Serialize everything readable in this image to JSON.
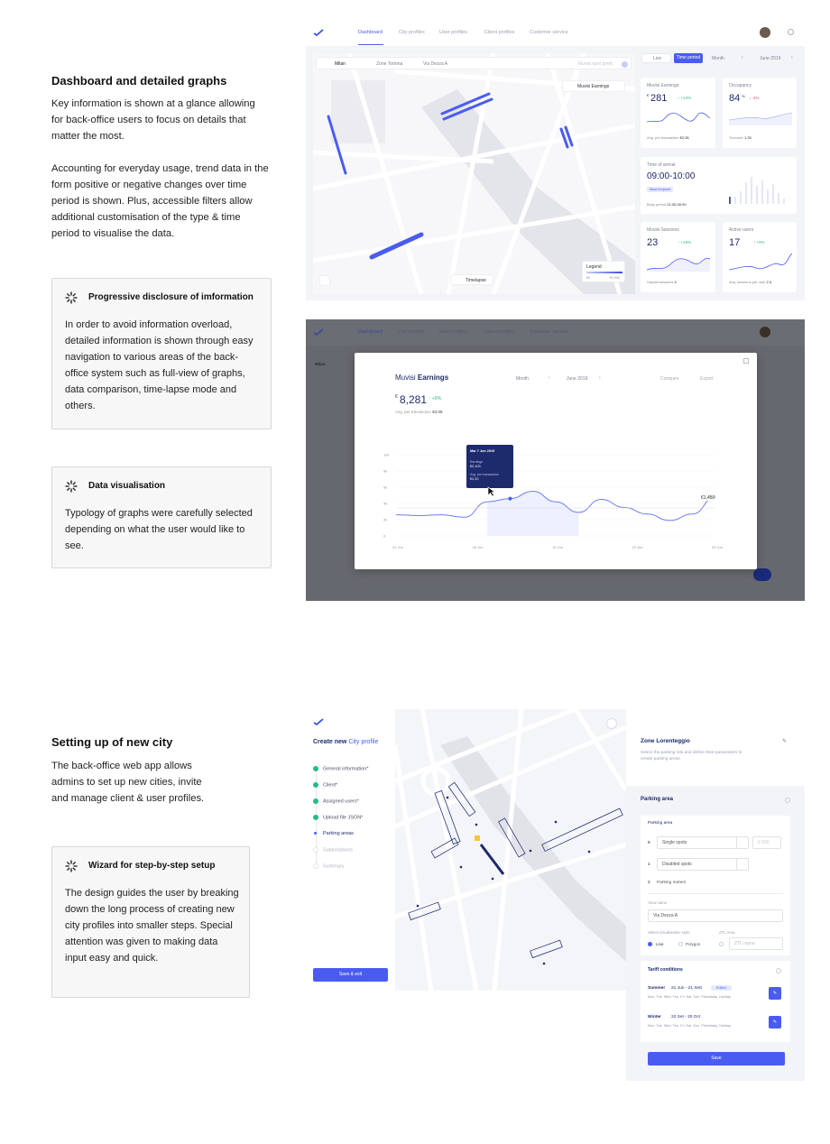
{
  "section1": {
    "title": "Dashboard and detailed graphs",
    "para1": "Key information is shown at a glance allowing for back-office users to focus on details that matter the most.",
    "para2": "Accounting for everyday usage, trend data in the form positive or negative changes over time period is shown. Plus, accessible filters allow additional customisation of the type & time period to visualise the data.",
    "card1": {
      "title": "Progressive disclosure of imformation",
      "text": "In order to avoid information overload, detailed information is shown through easy navigation to various areas of the back-office system such as full-view of graphs, data comparison, time-lapse mode and others."
    },
    "card2": {
      "title": "Data visualisation",
      "text": "Typology of graphs were carefully selected depending on what the user would like to see."
    }
  },
  "section2": {
    "title": "Setting up of new city",
    "para": "The back-office web app allows admins to set up new cities, invite and manage client & user profiles.",
    "card": {
      "title": "Wizard for step-by-step setup",
      "text": "The design guides the user by breaking down the long process of creating new city profiles into smaller steps. Special attention was given to making data input easy and quick."
    }
  },
  "dashboard": {
    "nav": [
      "Dashboard",
      "City profiles",
      "User profiles",
      "Client profiles",
      "Customer service"
    ],
    "filters": {
      "city": "Milan",
      "zone": "Zone Tortona",
      "street": "Via Dezza A",
      "search": "Muvisi spot (pmt)"
    },
    "layer": "Muvisi Earnings",
    "timelapse": "Timelapse",
    "legend": {
      "title": "Legend",
      "min": "€0",
      "max": "€1,000"
    },
    "toggle": {
      "live": "Live",
      "period": "Time period",
      "month": "Month",
      "date": "June 2019"
    },
    "widgets": {
      "earnings": {
        "title": "Muvisi Earnings",
        "value": "281",
        "currency": "€",
        "delta": "↑ +14%",
        "sub": "Avg. per transaction",
        "subval": "€2,05"
      },
      "occupancy": {
        "title": "Occupancy",
        "value": "84",
        "unit": "%",
        "delta": "↓ -2%",
        "sub": "Turnover",
        "subval": "1.25"
      },
      "arrival": {
        "title": "Time of arrival",
        "value": "09:00-10:00",
        "badge": "Most frequent",
        "sub": "Busy period",
        "subval": "21:30-00:00"
      },
      "sessions": {
        "title": "Muvisi Sessions",
        "value": "23",
        "delta": "↑ +15%",
        "sub": "Unpaid sessions",
        "subval": "4"
      },
      "users": {
        "title": "Active users",
        "value": "17",
        "delta": "↑ +9%",
        "sub": "Avg. sessions per user",
        "subval": "2.4"
      }
    }
  },
  "modal": {
    "title_a": "Muvisi",
    "title_b": "Earnings",
    "period": "Month",
    "date": "June 2019",
    "compare": "Compare",
    "export": "Export",
    "value": "8,281",
    "currency": "€",
    "delta": "↑ +9%",
    "sub": "Avg. per transaction",
    "subval": "€2,05",
    "tooltip": {
      "date": "Mar 7 Jun 2019",
      "l1": "Earnings",
      "v1": "€2,103",
      "l2": "Avg. per transaction",
      "v2": "€2,20"
    },
    "endlabel": "€1,450",
    "bg_street": "Milan"
  },
  "chart_data": {
    "type": "line",
    "x": [
      "01 Jun",
      "08 Jun",
      "15 Jun",
      "22 Jun",
      "29 Jun"
    ],
    "y_ticks": [
      "10k",
      "8k",
      "6k",
      "4k",
      "2k",
      "0"
    ],
    "series": [
      {
        "values": [
          2.6,
          2.5,
          2.6,
          2.3,
          4.2,
          4.6,
          5.5,
          4.2,
          2.9,
          4.5,
          3.5,
          2.7,
          1.9,
          2.7,
          4.8
        ]
      }
    ],
    "ylim": [
      0,
      10
    ]
  },
  "wizard": {
    "title_a": "Create new",
    "title_b": "City profile",
    "steps": [
      "General information*",
      "Client*",
      "Assigned users*",
      "Upload file JSON*",
      "Parking areas",
      "Subscriptions",
      "Summary"
    ],
    "save_exit": "Save & exit",
    "zone": {
      "title": "Zone Lorenteggio",
      "desc": "Select the parking lots and define their parameters to create parking areas"
    },
    "parking": {
      "title": "Parking area",
      "sub": "Parking area",
      "rows": [
        {
          "n": "6",
          "label": "Single spots",
          "extra": "€ 000"
        },
        {
          "n": "1",
          "label": "Disabled spots"
        },
        {
          "n": "2",
          "label": "Parking meters"
        }
      ],
      "area_label": "Area name",
      "area_value": "Via Dezza A",
      "vis_label": "Select visualisation style",
      "ztl_label": "ZTL Area",
      "opt_line": "Line",
      "opt_polygon": "Polygon",
      "ztl_placeholder": "ZTL name",
      "tariff": "Tariff conditions",
      "summer": {
        "name": "Summer",
        "dates": "21 Jun - 21 Sett",
        "badge": "Edited"
      },
      "winter": {
        "name": "Winter",
        "dates": "22 Set - 20 Oct"
      },
      "days": "Mon  Tue  Wed  Thu  Fri  Sat  Sun  Preholiday  Holiday",
      "save": "Save"
    }
  }
}
